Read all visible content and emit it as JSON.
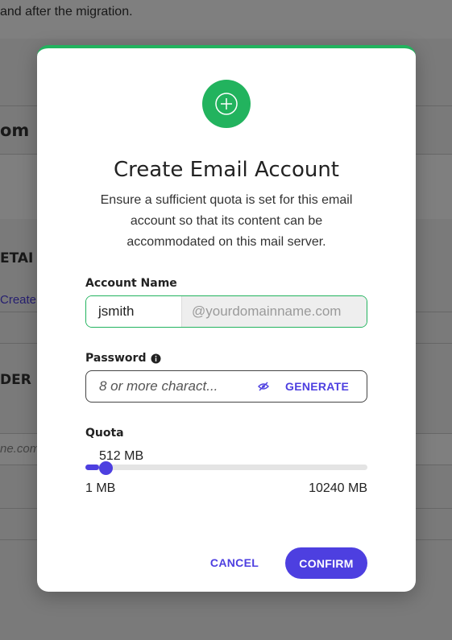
{
  "background": {
    "migration_text": "and after the migration.",
    "domain_heading_fragment": "om",
    "details_fragment": "ETAI",
    "create_link_fragment": "Create",
    "provider_fragment": "DER D",
    "domain_input_fragment": "ne.com"
  },
  "modal": {
    "icon": "plus-circle-icon",
    "title": "Create Email Account",
    "description": "Ensure a sufficient quota is set for this email account so that its content can be accommodated on this mail server.",
    "account_name": {
      "label": "Account Name",
      "value": "jsmith",
      "domain_suffix": "@yourdomainname.com"
    },
    "password": {
      "label": "Password",
      "info_icon": "info-icon",
      "placeholder": "8 or more charact...",
      "visibility_icon": "eye-slash-icon",
      "generate_label": "GENERATE"
    },
    "quota": {
      "label": "Quota",
      "current": "512 MB",
      "min": "1 MB",
      "max": "10240 MB",
      "value_mb": 512,
      "min_mb": 1,
      "max_mb": 10240
    },
    "buttons": {
      "cancel": "CANCEL",
      "confirm": "CONFIRM"
    }
  },
  "colors": {
    "accent_green": "#22b35e",
    "accent_purple": "#4d3fe0"
  }
}
